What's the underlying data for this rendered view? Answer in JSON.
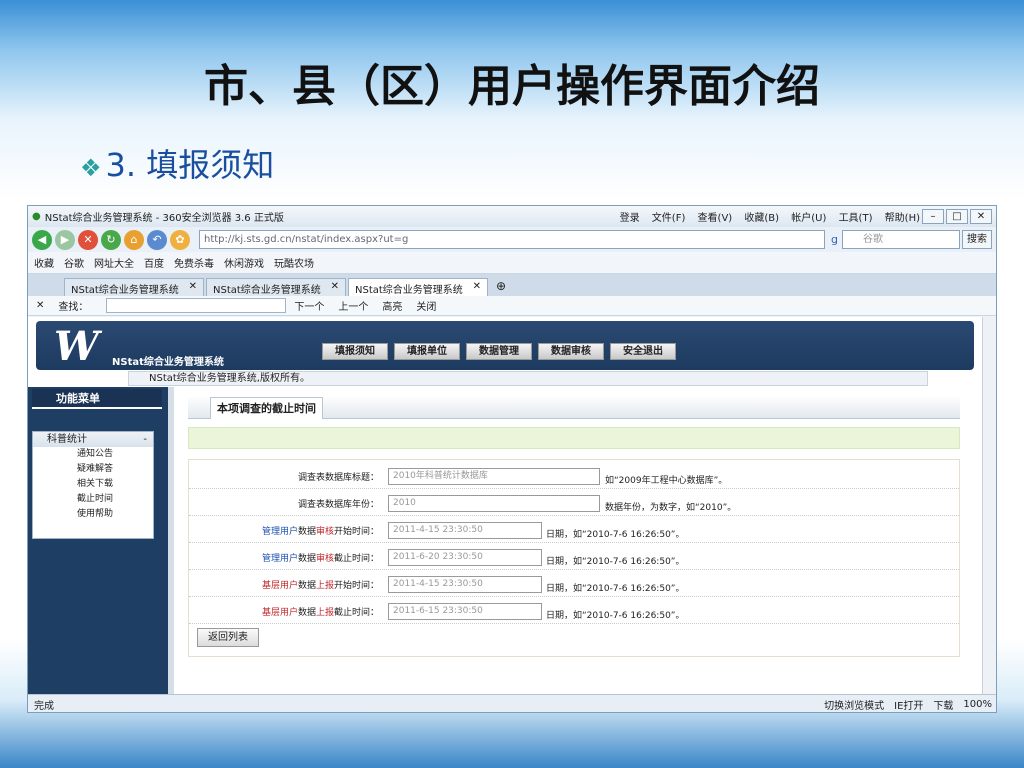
{
  "slide": {
    "title": "市、县（区）用户操作界面介绍",
    "bullet": "❖",
    "subtitle": "3. 填报须知"
  },
  "browser": {
    "window_title": "NStat综合业务管理系统 - 360安全浏览器 3.6 正式版",
    "menu": [
      "登录",
      "文件(F)",
      "查看(V)",
      "收藏(B)",
      "帐户(U)",
      "工具(T)",
      "帮助(H)"
    ],
    "url": "http://kj.sts.gd.cn/nstat/index.aspx?ut=g",
    "search_placeholder": "谷歌",
    "search_button": "搜索",
    "favorites": [
      "收藏",
      "谷歌",
      "网址大全",
      "百度",
      "免费杀毒",
      "休闲游戏",
      "玩酷农场"
    ],
    "tabs": [
      "NStat综合业务管理系统",
      "NStat综合业务管理系统",
      "NStat综合业务管理系统"
    ],
    "find": {
      "label": "查找：",
      "next": "下一个",
      "prev": "上一个",
      "highlight": "高亮",
      "close": "关闭"
    },
    "status": {
      "left": "完成",
      "switch_mode": "切换浏览模式",
      "ie_open": "IE打开",
      "download": "下载",
      "zoom": "100%"
    }
  },
  "site": {
    "logo_letter": "W",
    "logo_text": "NStat综合业务管理系统",
    "nav": [
      "填报须知",
      "填报单位",
      "数据管理",
      "数据审核",
      "安全退出"
    ],
    "notice": "NStat综合业务管理系统,版权所有。"
  },
  "sidebar": {
    "title": "功能菜单",
    "group": "科普统计",
    "items": [
      "通知公告",
      "疑难解答",
      "相关下载",
      "截止时间",
      "使用帮助"
    ]
  },
  "content": {
    "section_title": "本项调查的截止时间",
    "rows": [
      {
        "label": "调查表数据库标题：",
        "value": "2010年科普统计数据库",
        "hint": "如“2009年工程中心数据库”。"
      },
      {
        "label": "调查表数据库年份：",
        "value": "2010",
        "hint": "数据年份，为数字，如“2010”。"
      },
      {
        "label_a": "管理用户",
        "label_b": "数据",
        "label_c": "审核",
        "label_d": "开始时间：",
        "value": "2011-4-15 23:30:50",
        "hint": "日期，如“2010-7-6 16:26:50”。"
      },
      {
        "label_a": "管理用户",
        "label_b": "数据",
        "label_c": "审核",
        "label_d": "截止时间：",
        "value": "2011-6-20 23:30:50",
        "hint": "日期，如“2010-7-6 16:26:50”。"
      },
      {
        "label_a": "基层用户",
        "label_b": "数据",
        "label_c": "上报",
        "label_d": "开始时间：",
        "value": "2011-4-15 23:30:50",
        "hint": "日期，如“2010-7-6 16:26:50”。"
      },
      {
        "label_a": "基层用户",
        "label_b": "数据",
        "label_c": "上报",
        "label_d": "截止时间：",
        "value": "2011-6-15 23:30:50",
        "hint": "日期，如“2010-7-6 16:26:50”。"
      }
    ],
    "back_button": "返回列表"
  }
}
